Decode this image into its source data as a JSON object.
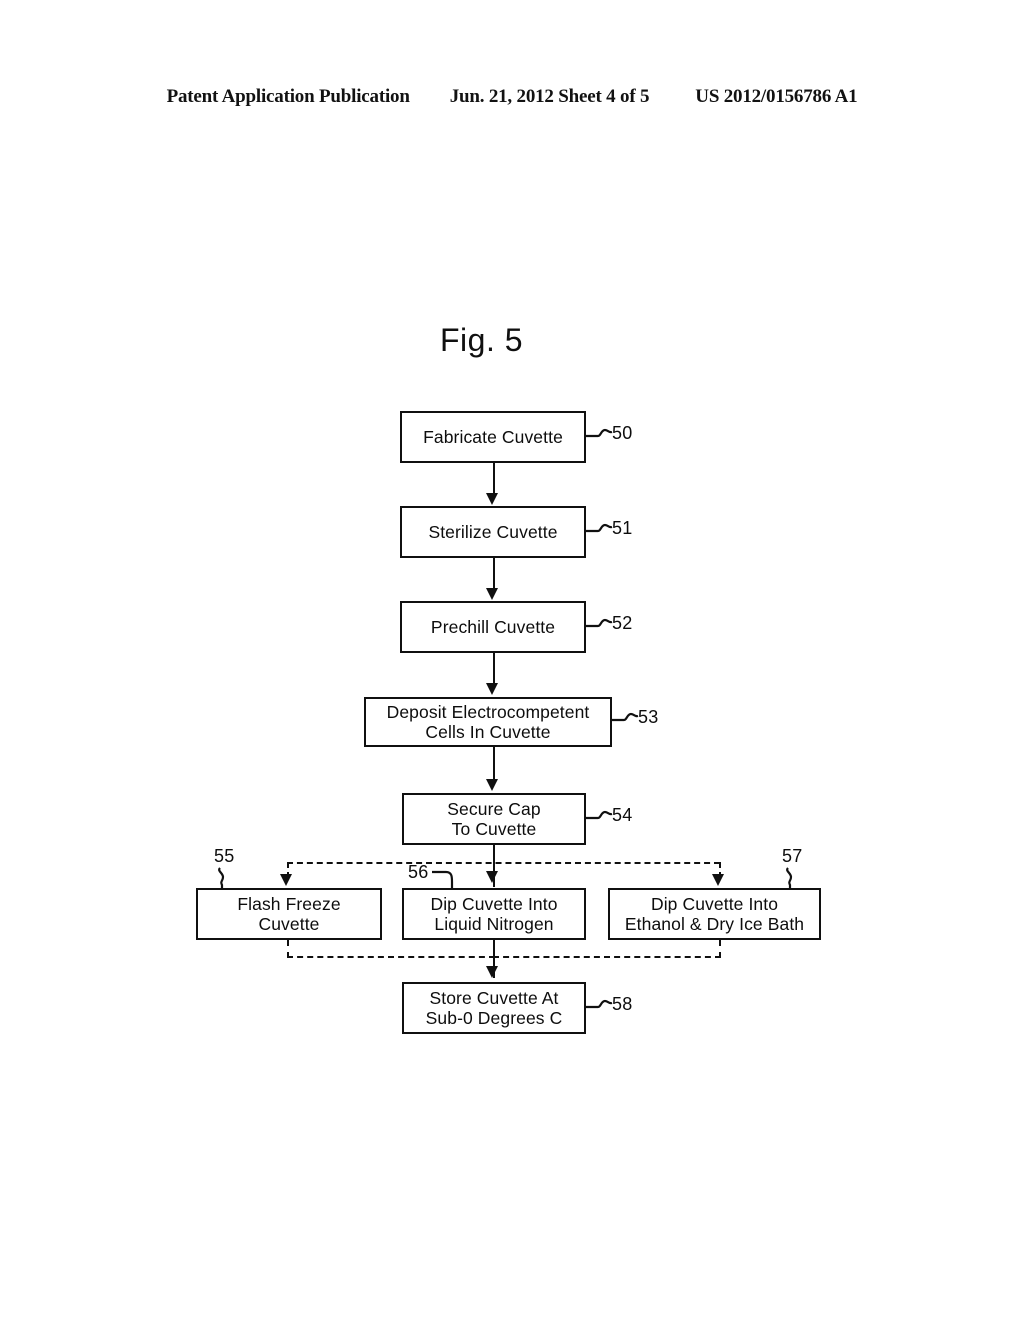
{
  "header": {
    "left": "Patent Application Publication",
    "middle": "Jun. 21, 2012  Sheet 4 of 5",
    "right": "US 2012/0156786 A1"
  },
  "figure": {
    "title": "Fig. 5",
    "ink_color": "#101010",
    "background": "#ffffff"
  },
  "chart_data": {
    "type": "diagram",
    "title": "Fig. 5",
    "subtype": "process-flowchart",
    "nodes": [
      {
        "ref": "50",
        "lines": [
          "Fabricate Cuvette"
        ]
      },
      {
        "ref": "51",
        "lines": [
          "Sterilize Cuvette"
        ]
      },
      {
        "ref": "52",
        "lines": [
          "Prechill Cuvette"
        ]
      },
      {
        "ref": "53",
        "lines": [
          "Deposit Electrocompetent",
          "Cells In Cuvette"
        ]
      },
      {
        "ref": "54",
        "lines": [
          "Secure Cap",
          "To Cuvette"
        ]
      },
      {
        "ref": "55",
        "lines": [
          "Flash Freeze",
          "Cuvette"
        ]
      },
      {
        "ref": "56",
        "lines": [
          "Dip Cuvette Into",
          "Liquid Nitrogen"
        ]
      },
      {
        "ref": "57",
        "lines": [
          "Dip Cuvette Into",
          "Ethanol & Dry Ice Bath"
        ]
      },
      {
        "ref": "58",
        "lines": [
          "Store Cuvette At",
          "Sub-0 Degrees C"
        ]
      }
    ],
    "edges": [
      {
        "from": "50",
        "to": "51",
        "style": "solid"
      },
      {
        "from": "51",
        "to": "52",
        "style": "solid"
      },
      {
        "from": "52",
        "to": "53",
        "style": "solid"
      },
      {
        "from": "53",
        "to": "54",
        "style": "solid"
      },
      {
        "from": "54",
        "to": "55",
        "style": "dashed"
      },
      {
        "from": "54",
        "to": "56",
        "style": "solid"
      },
      {
        "from": "54",
        "to": "57",
        "style": "dashed"
      },
      {
        "from": "55",
        "to": "58",
        "style": "dashed"
      },
      {
        "from": "56",
        "to": "58",
        "style": "solid"
      },
      {
        "from": "57",
        "to": "58",
        "style": "dashed"
      }
    ]
  },
  "nodes": {
    "n50": {
      "ref": "50",
      "l1": "Fabricate Cuvette"
    },
    "n51": {
      "ref": "51",
      "l1": "Sterilize Cuvette"
    },
    "n52": {
      "ref": "52",
      "l1": "Prechill Cuvette"
    },
    "n53": {
      "ref": "53",
      "l1": "Deposit Electrocompetent",
      "l2": "Cells In Cuvette"
    },
    "n54": {
      "ref": "54",
      "l1": "Secure Cap",
      "l2": "To Cuvette"
    },
    "n55": {
      "ref": "55",
      "l1": "Flash Freeze",
      "l2": "Cuvette"
    },
    "n56": {
      "ref": "56",
      "l1": "Dip Cuvette Into",
      "l2": "Liquid Nitrogen"
    },
    "n57": {
      "ref": "57",
      "l1": "Dip Cuvette Into",
      "l2": "Ethanol & Dry Ice Bath"
    },
    "n58": {
      "ref": "58",
      "l1": "Store Cuvette At",
      "l2": "Sub-0 Degrees C"
    }
  }
}
